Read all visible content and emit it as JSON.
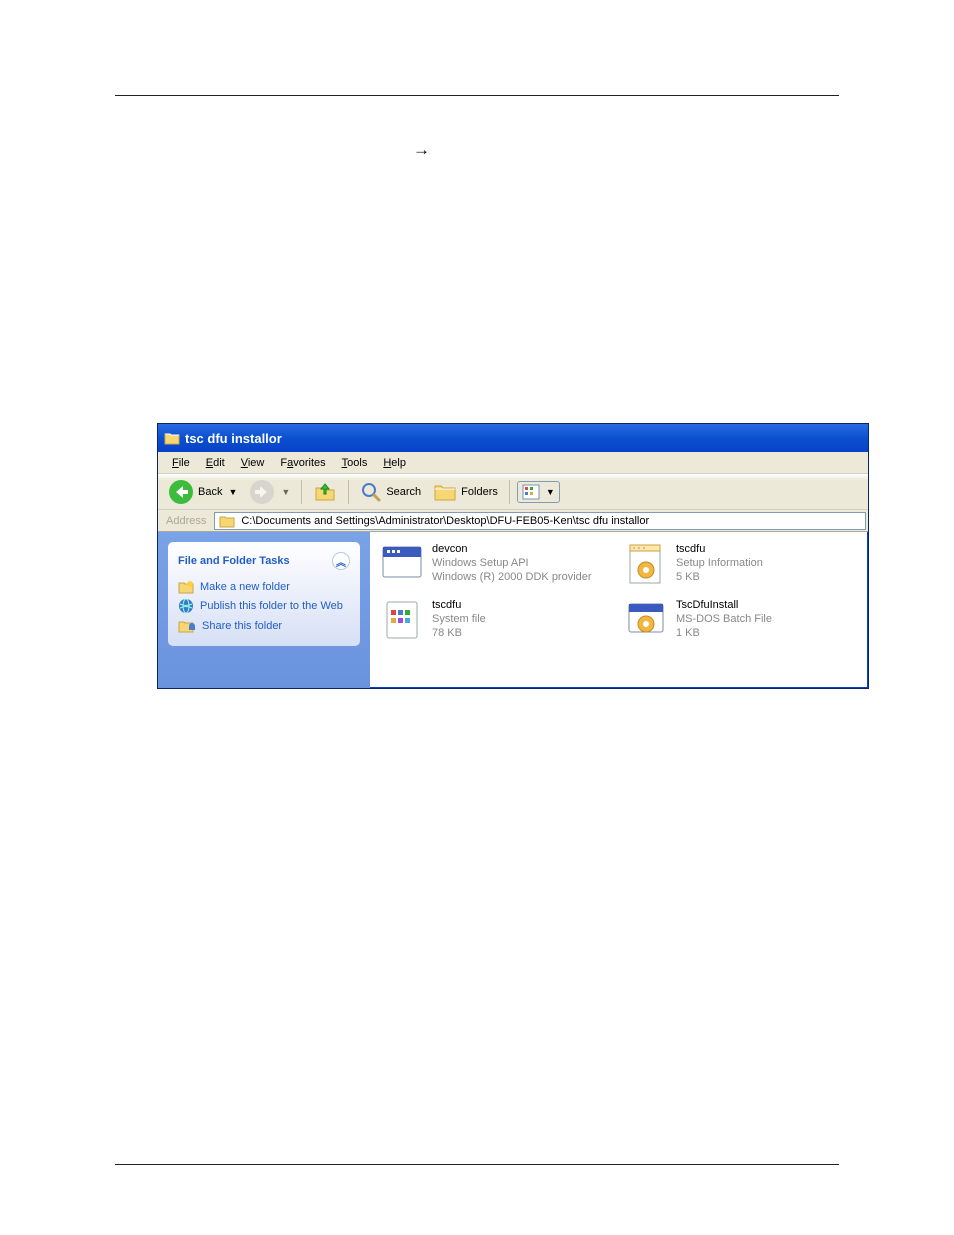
{
  "titlebar": {
    "title": "tsc dfu installor"
  },
  "arrow_glyph": "→",
  "menubar": {
    "file": "File",
    "edit": "Edit",
    "view": "View",
    "favorites": "Favorites",
    "tools": "Tools",
    "help": "Help"
  },
  "toolbar": {
    "back": "Back",
    "search": "Search",
    "folders": "Folders"
  },
  "addressbar": {
    "label": "Address",
    "path": "C:\\Documents and Settings\\Administrator\\Desktop\\DFU-FEB05-Ken\\tsc dfu installor"
  },
  "sidebar": {
    "panel_title": "File and Folder Tasks",
    "tasks": [
      "Make a new folder",
      "Publish this folder to the Web",
      "Share this folder"
    ]
  },
  "files": [
    {
      "name": "devcon",
      "sub1": "Windows Setup API",
      "sub2": "Windows (R) 2000 DDK provider"
    },
    {
      "name": "tscdfu",
      "sub1": "Setup Information",
      "sub2": "5 KB"
    },
    {
      "name": "tscdfu",
      "sub1": "System file",
      "sub2": "78 KB"
    },
    {
      "name": "TscDfuInstall",
      "sub1": "MS-DOS Batch File",
      "sub2": "1 KB"
    }
  ]
}
